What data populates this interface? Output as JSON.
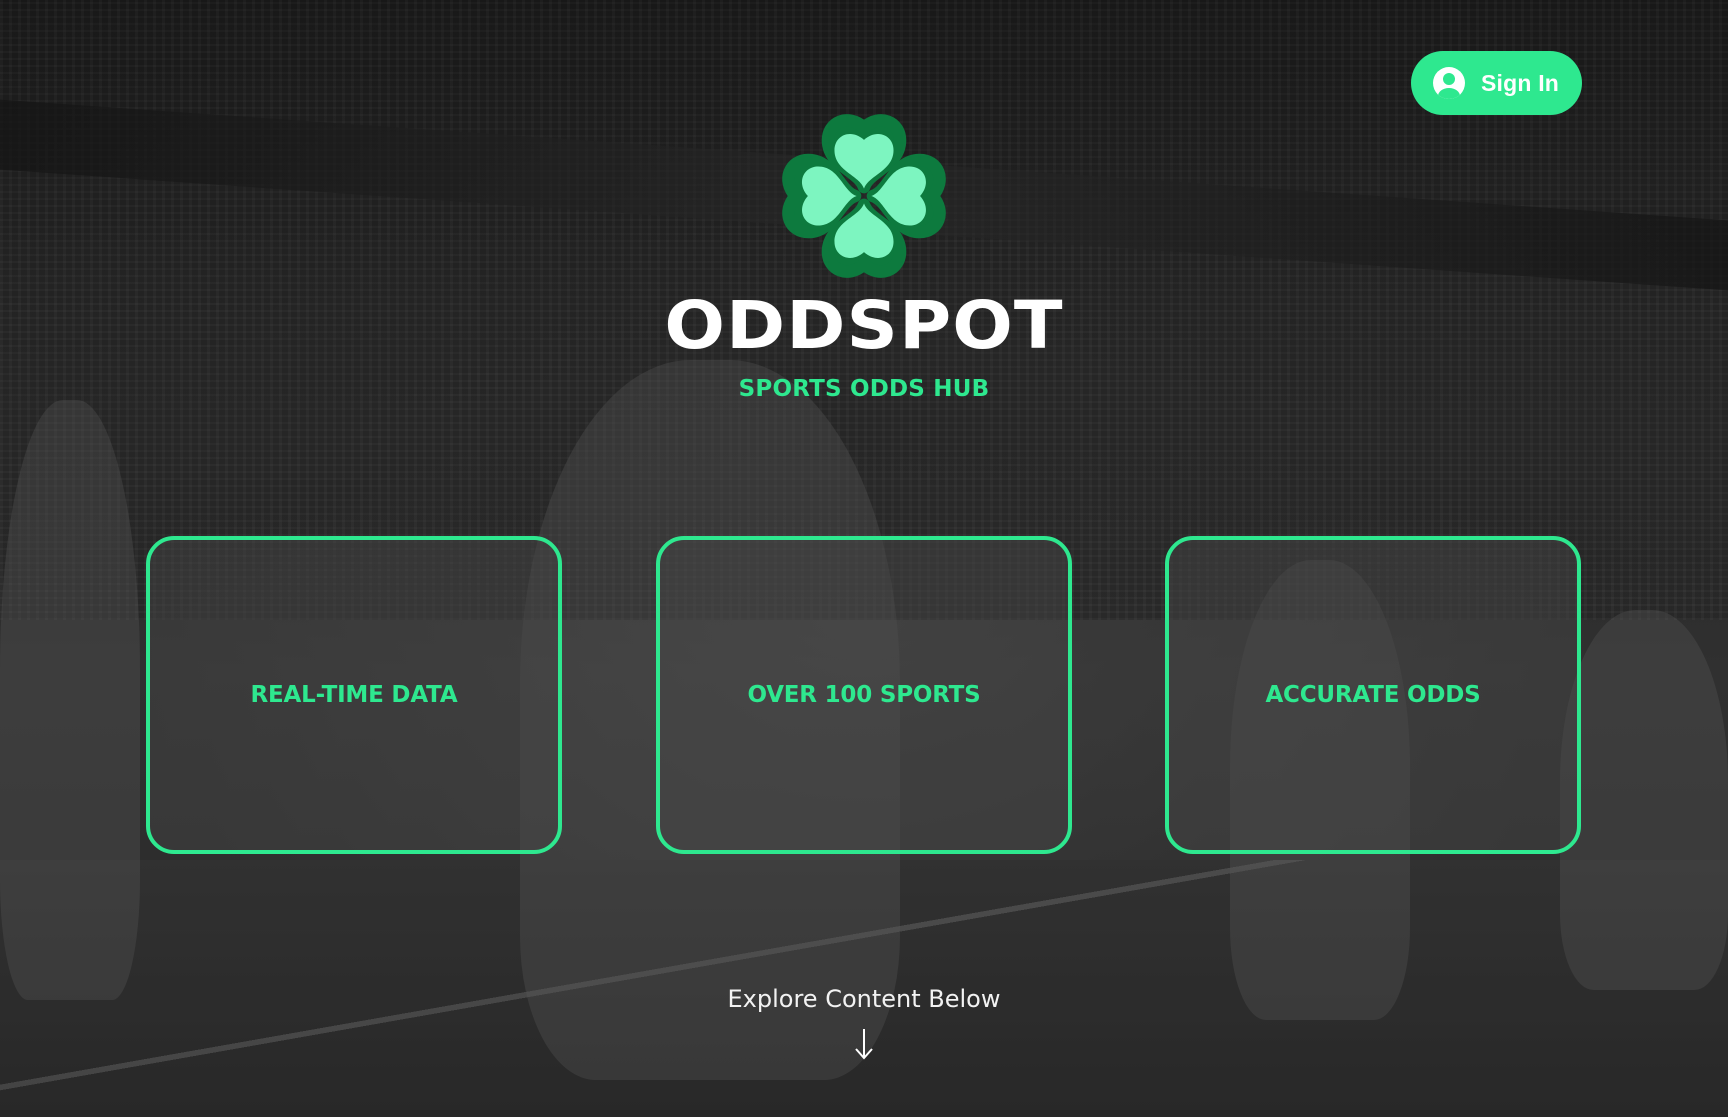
{
  "header": {
    "signin_label": "Sign In",
    "signin_icon": "user-circle-icon"
  },
  "brand": {
    "logo_icon": "four-leaf-clover-icon",
    "title": "ODDSPOT",
    "subtitle": "SPORTS ODDS HUB"
  },
  "features": [
    {
      "label": "REAL-TIME DATA"
    },
    {
      "label": "OVER 100 SPORTS"
    },
    {
      "label": "ACCURATE ODDS"
    }
  ],
  "footer": {
    "explore_text": "Explore Content Below",
    "arrow_icon": "arrow-down-icon"
  },
  "colors": {
    "accent": "#2ee88f",
    "logo_dark": "#0d7a3e",
    "logo_light": "#7df5c0",
    "text": "#ffffff"
  }
}
